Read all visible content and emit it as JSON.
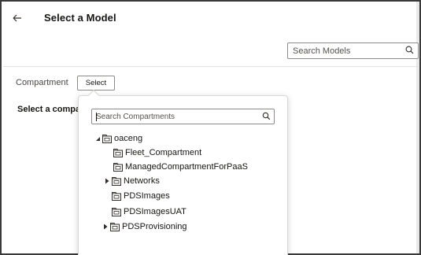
{
  "header": {
    "title": "Select a Model",
    "back_icon": "back-arrow-icon"
  },
  "search_models": {
    "placeholder": "Search Models",
    "icon": "search-icon"
  },
  "compartment": {
    "label": "Compartment",
    "select_label": "Select"
  },
  "main": {
    "heading": "Select a compa"
  },
  "popup": {
    "search": {
      "placeholder": "Search Compartments",
      "icon": "search-icon"
    },
    "tree": {
      "root": {
        "label": "oaceng",
        "expanded": true,
        "icon": "compartment-icon"
      },
      "items": [
        {
          "label": "Fleet_Compartment",
          "has_children": false,
          "icon": "compartment-icon"
        },
        {
          "label": "ManagedCompartmentForPaaS",
          "has_children": false,
          "icon": "compartment-icon"
        },
        {
          "label": "Networks",
          "has_children": true,
          "expanded": false,
          "icon": "compartment-icon"
        },
        {
          "label": "PDSImages",
          "has_children": false,
          "icon": "compartment-icon"
        },
        {
          "label": "PDSImagesUAT",
          "has_children": false,
          "icon": "compartment-icon"
        },
        {
          "label": "PDSProvisioning",
          "has_children": true,
          "expanded": false,
          "icon": "compartment-icon"
        }
      ]
    }
  }
}
